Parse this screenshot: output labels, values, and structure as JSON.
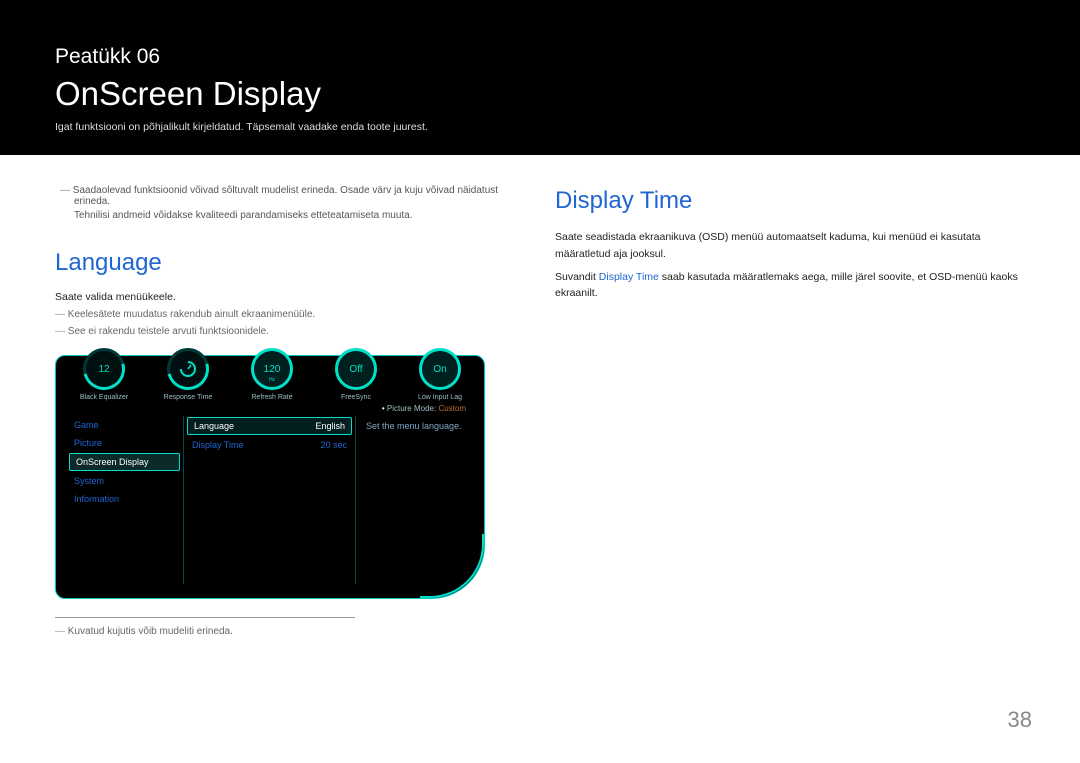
{
  "header": {
    "chapter": "Peatükk  06",
    "title": "OnScreen Display",
    "desc": "Igat funktsiooni on põhjalikult kirjeldatud. Täpsemalt vaadake enda toote juurest."
  },
  "top_note": {
    "line1": "Saadaolevad funktsioonid võivad sõltuvalt mudelist erineda. Osade värv ja kuju võivad näidatust erineda.",
    "line2": "Tehnilisi andmeid võidakse kvaliteedi parandamiseks etteteatamiseta muuta."
  },
  "language": {
    "heading": "Language",
    "line1": "Saate valida menüükeele.",
    "line2": "Keelesätete muudatus rakendub ainult ekraanimenüüle.",
    "line3": "See ei rakendu teistele arvuti funktsioonidele."
  },
  "osd": {
    "dials": [
      {
        "value": "12",
        "sub": "",
        "label": "Black Equalizer"
      },
      {
        "value": "",
        "sub": "",
        "label": "Response Time"
      },
      {
        "value": "120",
        "sub": "Hz",
        "label": "Refresh Rate"
      },
      {
        "value": "Off",
        "sub": "",
        "label": "FreeSync"
      },
      {
        "value": "On",
        "sub": "",
        "label": "Low Input Lag"
      }
    ],
    "picture_mode_label": "Picture Mode: ",
    "picture_mode_value": "Custom",
    "menu1": [
      {
        "label": "Game",
        "selected": false
      },
      {
        "label": "Picture",
        "selected": false
      },
      {
        "label": "OnScreen Display",
        "selected": true
      },
      {
        "label": "System",
        "selected": false
      },
      {
        "label": "Information",
        "selected": false
      }
    ],
    "menu2": [
      {
        "label": "Language",
        "value": "English",
        "selected": true
      },
      {
        "label": "Display Time",
        "value": "20 sec",
        "selected": false
      }
    ],
    "menu3_desc": "Set the menu language."
  },
  "bottom_note": "Kuvatud kujutis võib mudeliti erineda.",
  "display_time": {
    "heading": "Display Time",
    "p1": "Saate seadistada ekraanikuva (OSD) menüü automaatselt kaduma, kui menüüd ei kasutata määratletud aja jooksul.",
    "p2a": "Suvandit ",
    "p2accent": "Display Time",
    "p2b": " saab kasutada määratlemaks aega, mille järel soovite, et OSD-menüü kaoks ekraanilt."
  },
  "page_number": "38"
}
